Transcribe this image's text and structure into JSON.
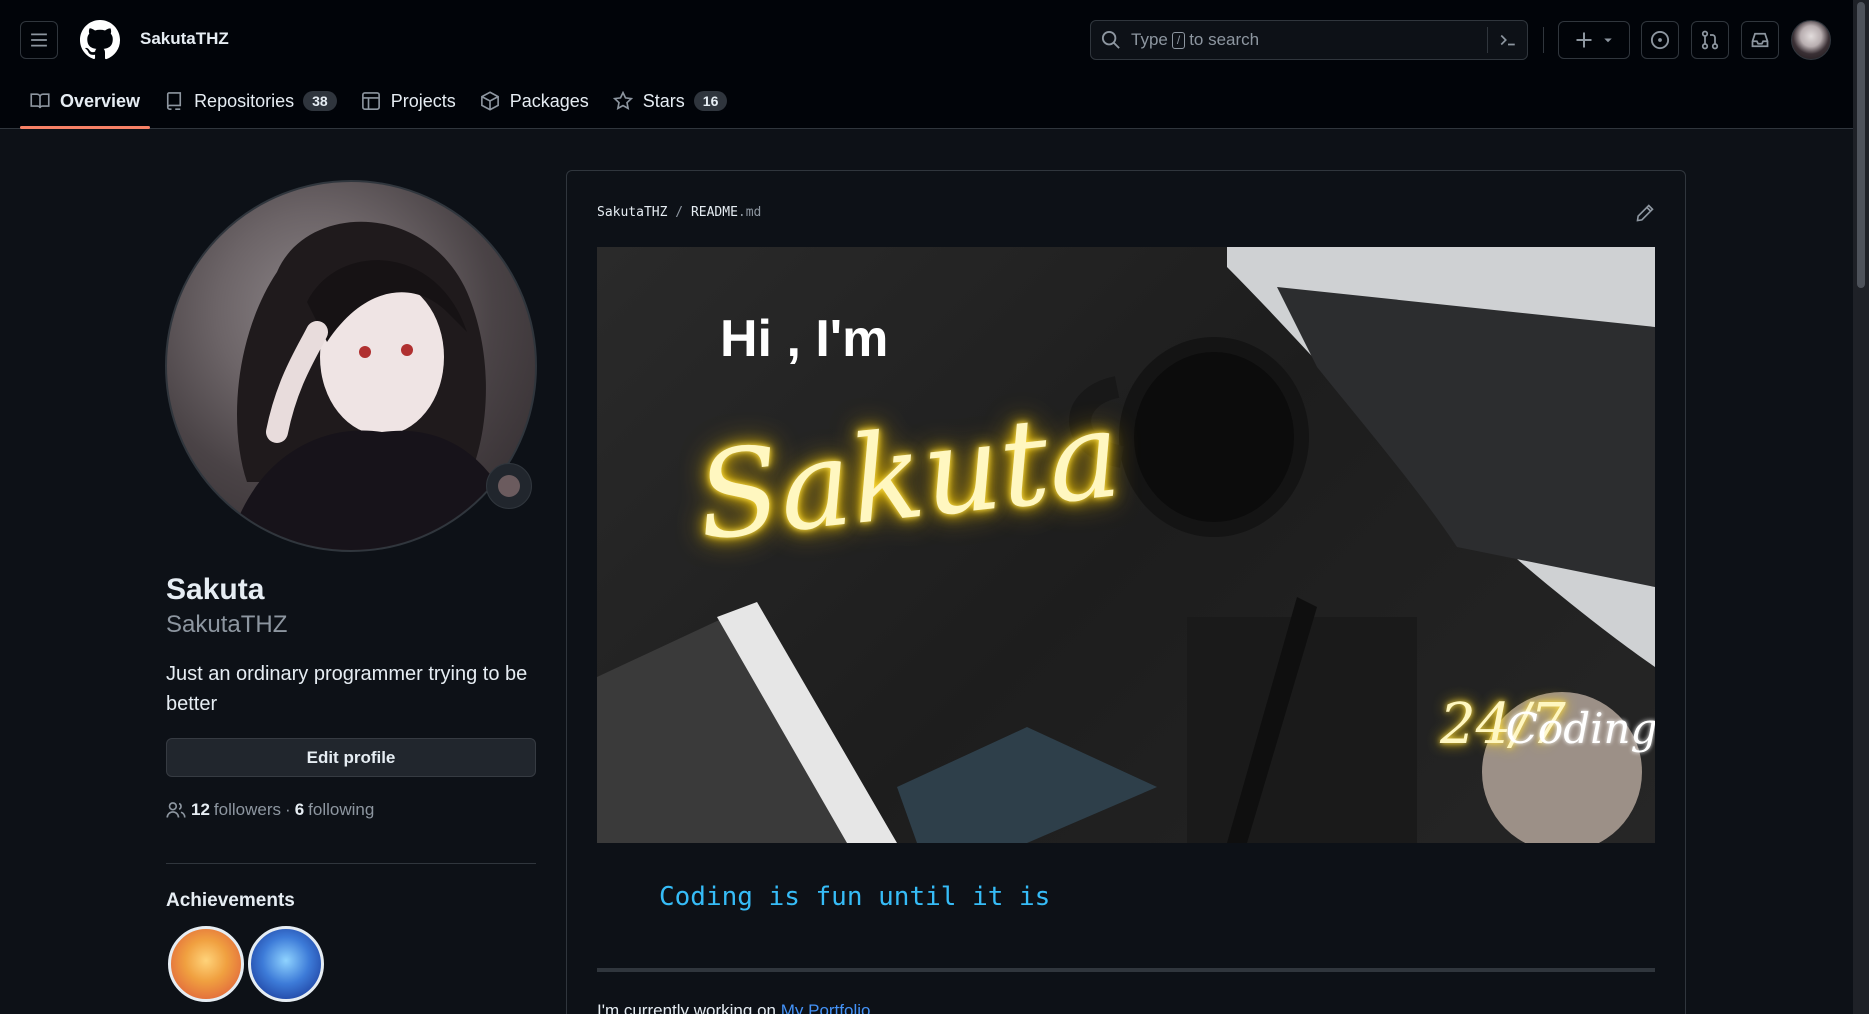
{
  "header": {
    "username": "SakutaTHZ",
    "search": {
      "prefix": "Type",
      "key": "/",
      "suffix": "to search"
    },
    "icons": [
      "hamburger-icon",
      "github-logo-icon",
      "search-icon",
      "command-palette-icon",
      "plus-icon",
      "issues-icon",
      "pull-requests-icon",
      "inbox-icon"
    ]
  },
  "tabs": [
    {
      "label": "Overview",
      "active": true
    },
    {
      "label": "Repositories",
      "count": "38"
    },
    {
      "label": "Projects"
    },
    {
      "label": "Packages"
    },
    {
      "label": "Stars",
      "count": "16"
    }
  ],
  "profile": {
    "name": "Sakuta",
    "login": "SakutaTHZ",
    "bio": "Just an ordinary programmer trying to be better",
    "edit_label": "Edit profile",
    "followers_count": "12",
    "followers_label": "followers",
    "separator": "·",
    "following_count": "6",
    "following_label": "following",
    "achievements_title": "Achievements"
  },
  "readme": {
    "path_user": "SakutaTHZ",
    "path_sep": "/",
    "path_file": "README",
    "path_ext": ".md",
    "banner": {
      "greeting": "Hi , I'm",
      "name": "Sakuta",
      "corner_text": "24/7",
      "corner_alt": "Coding"
    },
    "tagline": "Coding is fun until it is",
    "bullet_prefix": "I'm currently working on",
    "bullet_link": "My Portfolio"
  },
  "colors": {
    "accent_tab": "#f78166",
    "link": "#4493f8",
    "tagline": "#36bcf7",
    "neon": "#ffd000"
  }
}
